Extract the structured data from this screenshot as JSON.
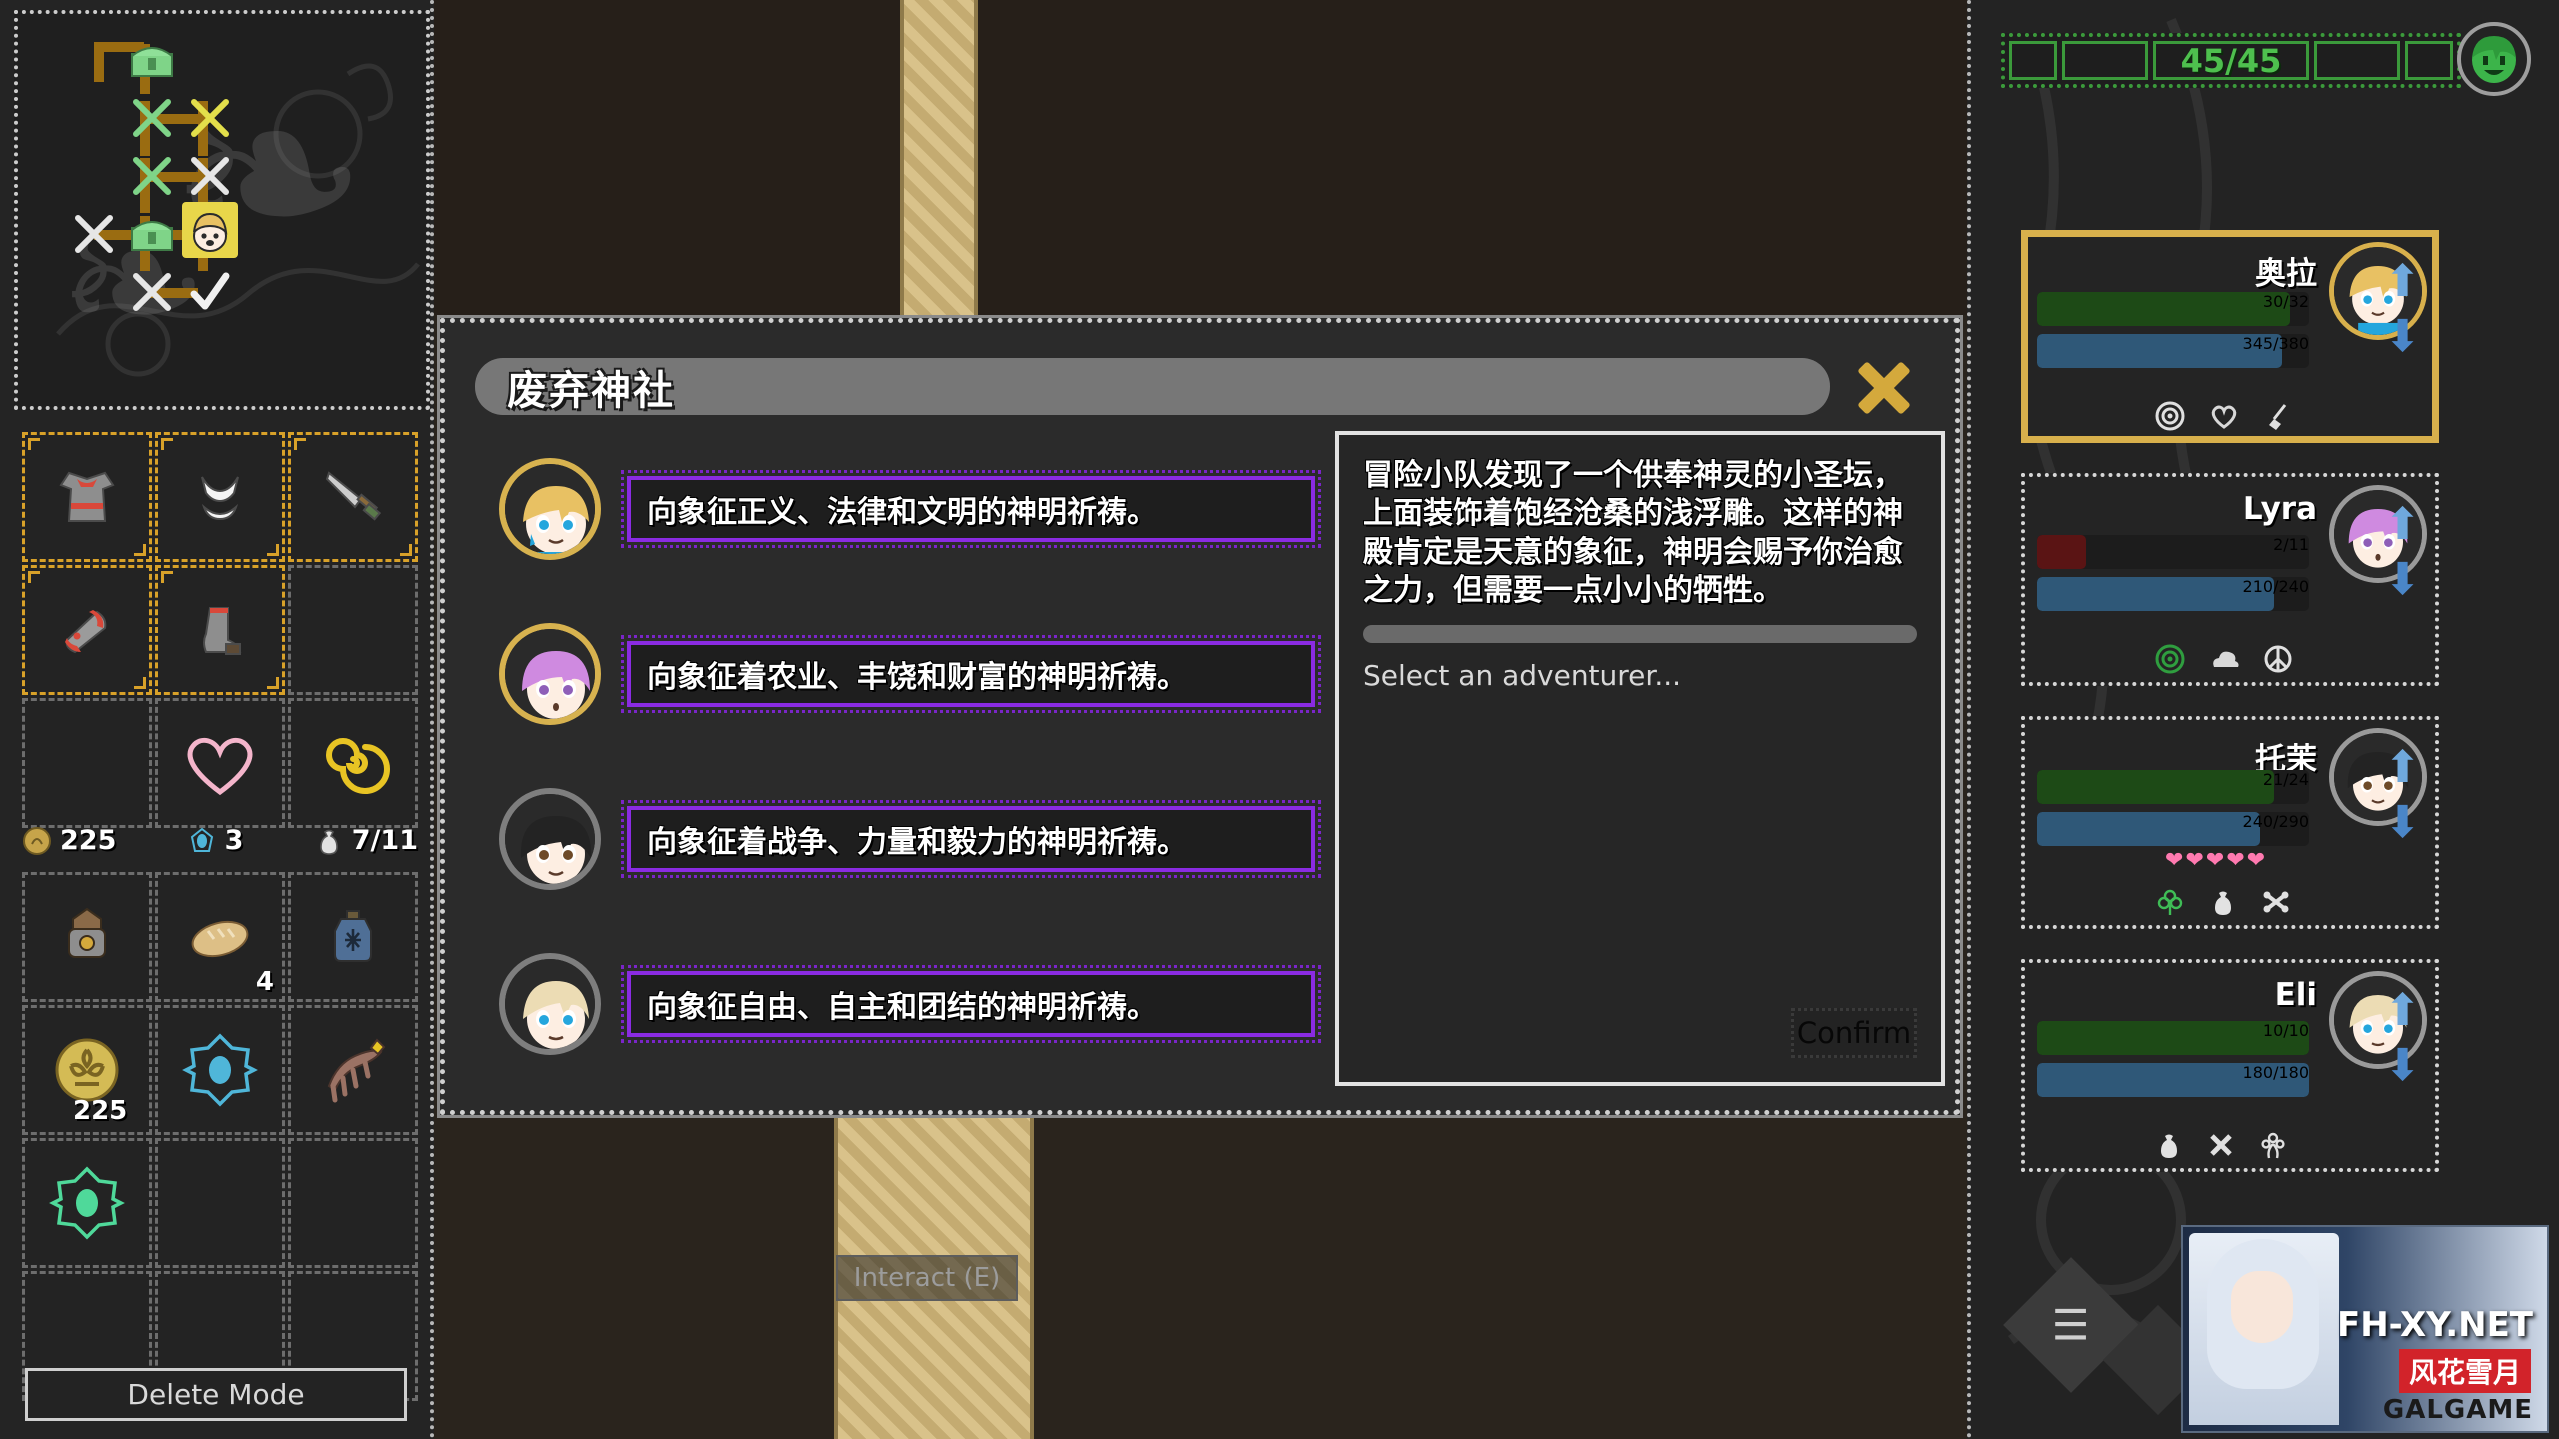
{
  "left_panel": {
    "map": {
      "nodes": [
        {
          "id": "n1",
          "type": "empty-room",
          "icon": "",
          "col": 0,
          "row": 0
        },
        {
          "id": "n2",
          "type": "treasure",
          "icon": "chest-green",
          "col": 1,
          "row": 0
        },
        {
          "id": "n3",
          "type": "battle-easy",
          "icon": "crossed-swords-green",
          "col": 1,
          "row": 1
        },
        {
          "id": "n4",
          "type": "battle-elite",
          "icon": "crossed-swords-yellow",
          "col": 2,
          "row": 1
        },
        {
          "id": "n5",
          "type": "battle-easy",
          "icon": "crossed-swords-green",
          "col": 1,
          "row": 2
        },
        {
          "id": "n6",
          "type": "battle-normal",
          "icon": "crossed-swords-white",
          "col": 2,
          "row": 2
        },
        {
          "id": "n7",
          "type": "battle-normal",
          "icon": "crossed-swords-white",
          "col": 0,
          "row": 3
        },
        {
          "id": "n8",
          "type": "treasure",
          "icon": "chest-green",
          "col": 1,
          "row": 3
        },
        {
          "id": "n9",
          "type": "player",
          "icon": "player-head",
          "col": 2,
          "row": 3
        },
        {
          "id": "n10",
          "type": "battle-normal",
          "icon": "crossed-swords-white",
          "col": 1,
          "row": 4
        },
        {
          "id": "n11",
          "type": "cleared",
          "icon": "checkmark-white",
          "col": 2,
          "row": 4
        }
      ]
    },
    "equipment": {
      "slots": [
        {
          "name": "body-armor",
          "icon": "armor",
          "equipped": true,
          "qty": null
        },
        {
          "name": "underwear",
          "icon": "underwear",
          "equipped": true,
          "qty": null
        },
        {
          "name": "weapon",
          "icon": "sword",
          "equipped": true,
          "qty": null
        },
        {
          "name": "gauntlet",
          "icon": "gauntlet",
          "equipped": true,
          "qty": null
        },
        {
          "name": "boots",
          "icon": "boots",
          "equipped": true,
          "qty": null
        },
        {
          "name": "empty-slot",
          "icon": "",
          "equipped": false,
          "qty": null
        },
        {
          "name": "empty-slot",
          "icon": "",
          "equipped": false,
          "qty": null
        },
        {
          "name": "heart-accessory",
          "icon": "heart-outline-pink",
          "equipped": false,
          "qty": null
        },
        {
          "name": "spiral-accessory",
          "icon": "spiral-yellow",
          "equipped": false,
          "qty": null
        }
      ]
    },
    "stats": {
      "gold_icon": "coin-icon",
      "gold": "225",
      "gem_icon": "gem-icon",
      "gems": "3",
      "bag_icon": "pouch-icon",
      "bag": "7/11"
    },
    "inventory": {
      "slots": [
        {
          "name": "backpack",
          "icon": "backpack",
          "qty": null
        },
        {
          "name": "bread",
          "icon": "bread",
          "qty": "4"
        },
        {
          "name": "frost-potion",
          "icon": "potion-blue",
          "qty": null
        },
        {
          "name": "gold-coin-stack",
          "icon": "coin-gold-large",
          "qty": "225"
        },
        {
          "name": "blue-rune",
          "icon": "rune-blue",
          "qty": null
        },
        {
          "name": "claw-weapon",
          "icon": "claws-brown",
          "qty": null
        },
        {
          "name": "green-rune",
          "icon": "rune-green",
          "qty": null
        },
        {
          "name": "empty-slot",
          "icon": "",
          "qty": null
        },
        {
          "name": "empty-slot",
          "icon": "",
          "qty": null
        },
        {
          "name": "empty-slot",
          "icon": "",
          "qty": null
        },
        {
          "name": "empty-slot",
          "icon": "",
          "qty": null
        },
        {
          "name": "empty-slot",
          "icon": "",
          "qty": null
        }
      ]
    },
    "delete_mode_label": "Delete Mode"
  },
  "center": {
    "interact_prompt": "Interact (E)"
  },
  "dialog": {
    "title": "废弃神社",
    "close_icon": "close-x-icon",
    "options": [
      {
        "portrait": "aura-blonde",
        "portrait_style": "gold",
        "text": "向象征正义、法律和文明的神明祈祷。"
      },
      {
        "portrait": "lyra-purple",
        "portrait_style": "gold",
        "text": "向象征着农业、丰饶和财富的神明祈祷。"
      },
      {
        "portrait": "tomo-black",
        "portrait_style": "gray",
        "text": "向象征着战争、力量和毅力的神明祈祷。"
      },
      {
        "portrait": "eli-blonde",
        "portrait_style": "gray",
        "text": "向象征自由、自主和团结的神明祈祷。"
      }
    ],
    "description": "冒险小队发现了一个供奉神灵的小圣坛，上面装饰着饱经沧桑的浅浮雕。这样的神殿肯定是天意的象征，神明会赐予你治愈之力，但需要一点小小的牺牲。",
    "hint": "Select an adventurer...",
    "confirm_label": "Confirm"
  },
  "right_panel": {
    "top_bar": {
      "value": "45/45",
      "segments": 5,
      "color": "#3b9a3b",
      "avatar_icon": "green-face-icon"
    },
    "party": [
      {
        "name": "奥拉",
        "hp": "30/32",
        "hp_pct": 93,
        "hp_color": "#1d4a16",
        "mp": "345/380",
        "mp_pct": 90,
        "mp_color": "#2f5878",
        "selected": true,
        "hearts": 0,
        "icons": [
          "target-icon",
          "heart-shield-icon",
          "broom-icon"
        ]
      },
      {
        "name": "Lyra",
        "hp": "2/11",
        "hp_pct": 18,
        "hp_color": "#5a1414",
        "mp": "210/240",
        "mp_pct": 87,
        "mp_color": "#2f5878",
        "selected": false,
        "hearts": 0,
        "icons": [
          "target-green-icon",
          "cloud-icon",
          "peace-icon"
        ]
      },
      {
        "name": "托茉",
        "hp": "21/24",
        "hp_pct": 87,
        "hp_color": "#1d4a16",
        "mp": "240/290",
        "mp_pct": 82,
        "mp_color": "#2f5878",
        "selected": false,
        "hearts": 5,
        "icons": [
          "clover-icon",
          "pouch-icon",
          "crossbones-icon"
        ]
      },
      {
        "name": "Eli",
        "hp": "10/10",
        "hp_pct": 100,
        "hp_color": "#1d4a16",
        "mp": "180/180",
        "mp_pct": 100,
        "mp_color": "#2f5878",
        "selected": false,
        "hearts": 0,
        "icons": [
          "pouch-icon",
          "cross-icon",
          "ornament-icon"
        ]
      }
    ],
    "menu_icon": "list-menu-icon"
  },
  "banner": {
    "url": "FH-XY.NET",
    "cn_text": "风花雪月",
    "sub_text": "GALGAME"
  }
}
